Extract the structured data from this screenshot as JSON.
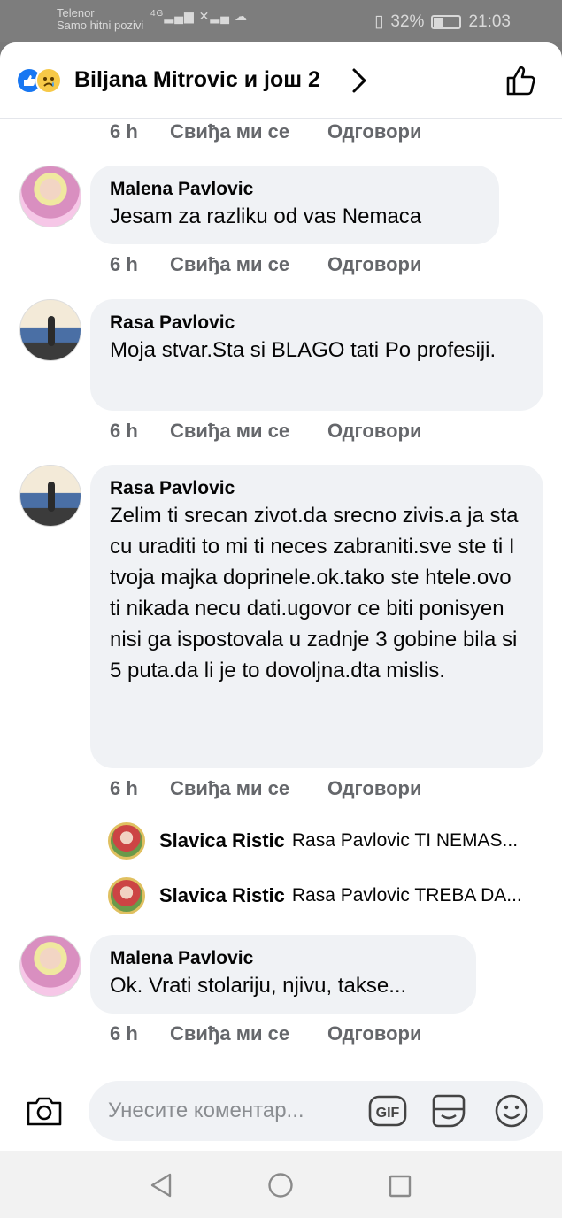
{
  "status_bar": {
    "carrier": "Telenor",
    "carrier_note": "Samo hitni pozivi",
    "network": "4G",
    "battery": "32%",
    "battery_level": 0.32,
    "time": "21:03"
  },
  "header": {
    "title": "Biljana Mitrovic и још 2",
    "reactions": [
      "like-icon",
      "sad-icon"
    ]
  },
  "actions": {
    "time": "6 h",
    "like": "Свиђа ми се",
    "reply": "Одговори"
  },
  "comments": [
    {
      "author": "Malena Pavlovic",
      "text": "Jesam za razliku od vas Nemaca",
      "time": "6 h"
    },
    {
      "author": "Rasa Pavlovic",
      "text": "Moja stvar.Sta si BLAGO tati Po profesiji.",
      "time": "6 h"
    },
    {
      "author": "Rasa Pavlovic",
      "text": "Zelim ti srecan zivot.da srecno zivis.a ja sta cu uraditi to mi ti neces zabraniti.sve ste ti I tvoja majka doprinele.ok.tako ste htele.ovo ti nikada necu dati.ugovor ce biti ponisyen nisi ga ispostovala u zadnje 3 gobine bila si 5 puta.da li je to dovoljna.dta mislis.",
      "time": "6 h"
    },
    {
      "author": "Malena Pavlovic",
      "text": "Ok. Vrati stolariju, njivu, takse...",
      "time": "6 h"
    }
  ],
  "replies": [
    {
      "author": "Slavica Ristic",
      "text": "Rasa Pavlovic TI NEMAS..."
    },
    {
      "author": "Slavica Ristic",
      "text": "Rasa Pavlovic TREBA DA..."
    }
  ],
  "composer": {
    "placeholder": "Унесите коментар...",
    "gif_label": "GIF"
  }
}
